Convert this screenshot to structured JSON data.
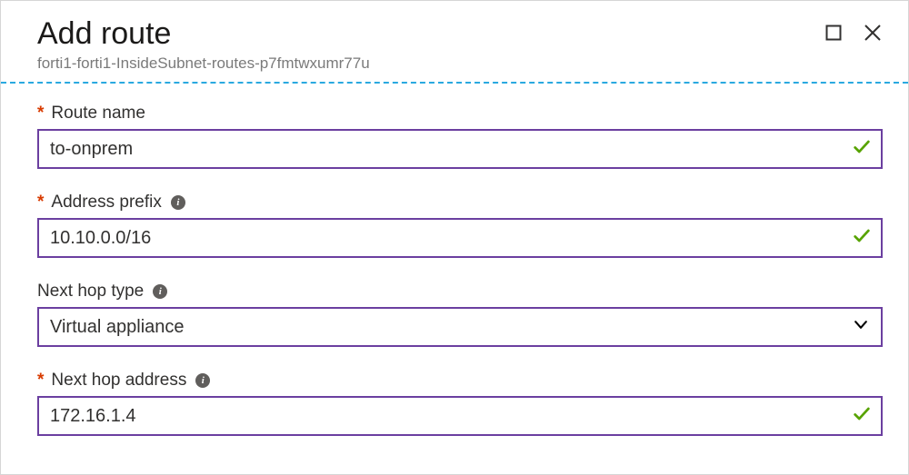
{
  "header": {
    "title": "Add route",
    "subtitle": "forti1-forti1-InsideSubnet-routes-p7fmtwxumr77u"
  },
  "fields": {
    "route_name": {
      "label": "Route name",
      "value": "to-onprem",
      "required": true,
      "valid": true
    },
    "address_prefix": {
      "label": "Address prefix",
      "value": "10.10.0.0/16",
      "required": true,
      "valid": true
    },
    "next_hop_type": {
      "label": "Next hop type",
      "value": "Virtual appliance",
      "required": false
    },
    "next_hop_address": {
      "label": "Next hop address",
      "value": "172.16.1.4",
      "required": true,
      "valid": true
    }
  },
  "icons": {
    "info_glyph": "i"
  }
}
